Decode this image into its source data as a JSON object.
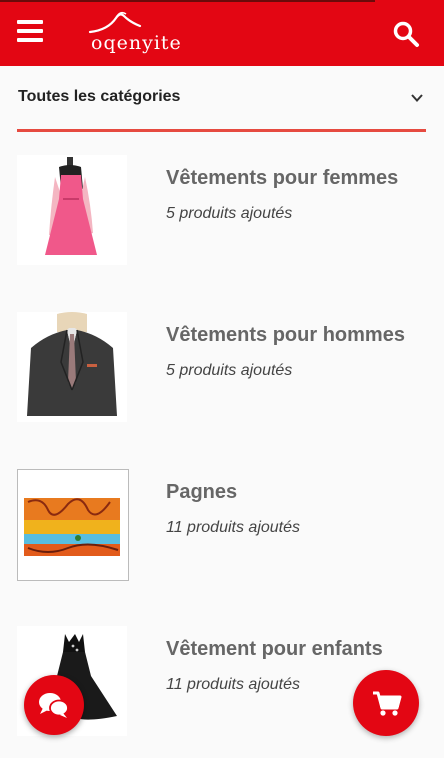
{
  "header": {
    "brand": "oqenyite",
    "menu_icon": "hamburger-menu-icon",
    "search_icon": "search-icon",
    "bar_color": "#e30613"
  },
  "category_filter": {
    "selected": "Toutes les catégories",
    "icon": "chevron-down-icon",
    "underline_color": "#e64a40"
  },
  "categories": [
    {
      "title": "Vêtements pour femmes",
      "count": "5 produits ajoutés"
    },
    {
      "title": "Vêtements pour hommes",
      "count": "5 produits ajoutés"
    },
    {
      "title": "Pagnes",
      "count": "11 produits ajoutés"
    },
    {
      "title": "Vêtement pour enfants",
      "count": "11 produits ajoutés"
    }
  ],
  "fabs": {
    "chat_icon": "chat-bubbles-icon",
    "cart_icon": "shopping-cart-icon"
  }
}
